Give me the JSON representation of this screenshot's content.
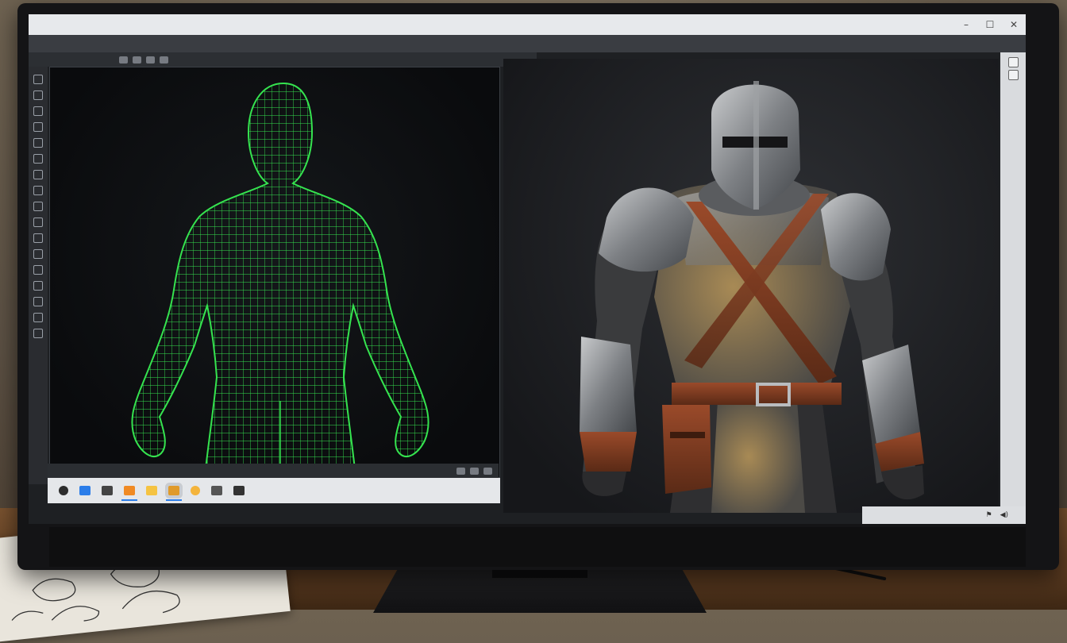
{
  "app": {
    "window_title": "",
    "window_controls": [
      "–",
      "☐",
      "✕"
    ]
  },
  "menubar": {
    "items": [
      "",
      "",
      "",
      "",
      "",
      "",
      "",
      ""
    ]
  },
  "toolbar": {
    "items": [
      "",
      ""
    ]
  },
  "left_toolbar": {
    "icons": [
      "select-icon",
      "move-icon",
      "rotate-icon",
      "scale-icon",
      "brush-icon",
      "pen-icon",
      "grid-icon",
      "mesh-icon",
      "camera-icon",
      "light-icon",
      "material-icon",
      "layer-icon",
      "settings-icon",
      "info-icon",
      "shield-icon",
      "globe-icon",
      "render-icon"
    ]
  },
  "viewports": {
    "left": {
      "content": "wireframe-humanoid",
      "wire_color": "#35e34f"
    },
    "right": {
      "content": "armored-knight-render",
      "armor_color": "#8d8f92",
      "leather_color": "#7a3b22"
    }
  },
  "statusbar": {
    "items": [
      "",
      ""
    ]
  },
  "taskbar": {
    "icons": [
      "start-icon",
      "browser-icon",
      "folder-icon",
      "app-icon",
      "files-icon",
      "active-app-icon",
      "media-icon",
      "notes-icon",
      "store-icon"
    ]
  },
  "tray": {
    "icons": [
      "network-icon",
      "volume-icon"
    ],
    "time": "",
    "date": ""
  },
  "colors": {
    "screen_bg": "#1e2023",
    "accent": "#2b7de9",
    "wireframe": "#35e34f"
  }
}
